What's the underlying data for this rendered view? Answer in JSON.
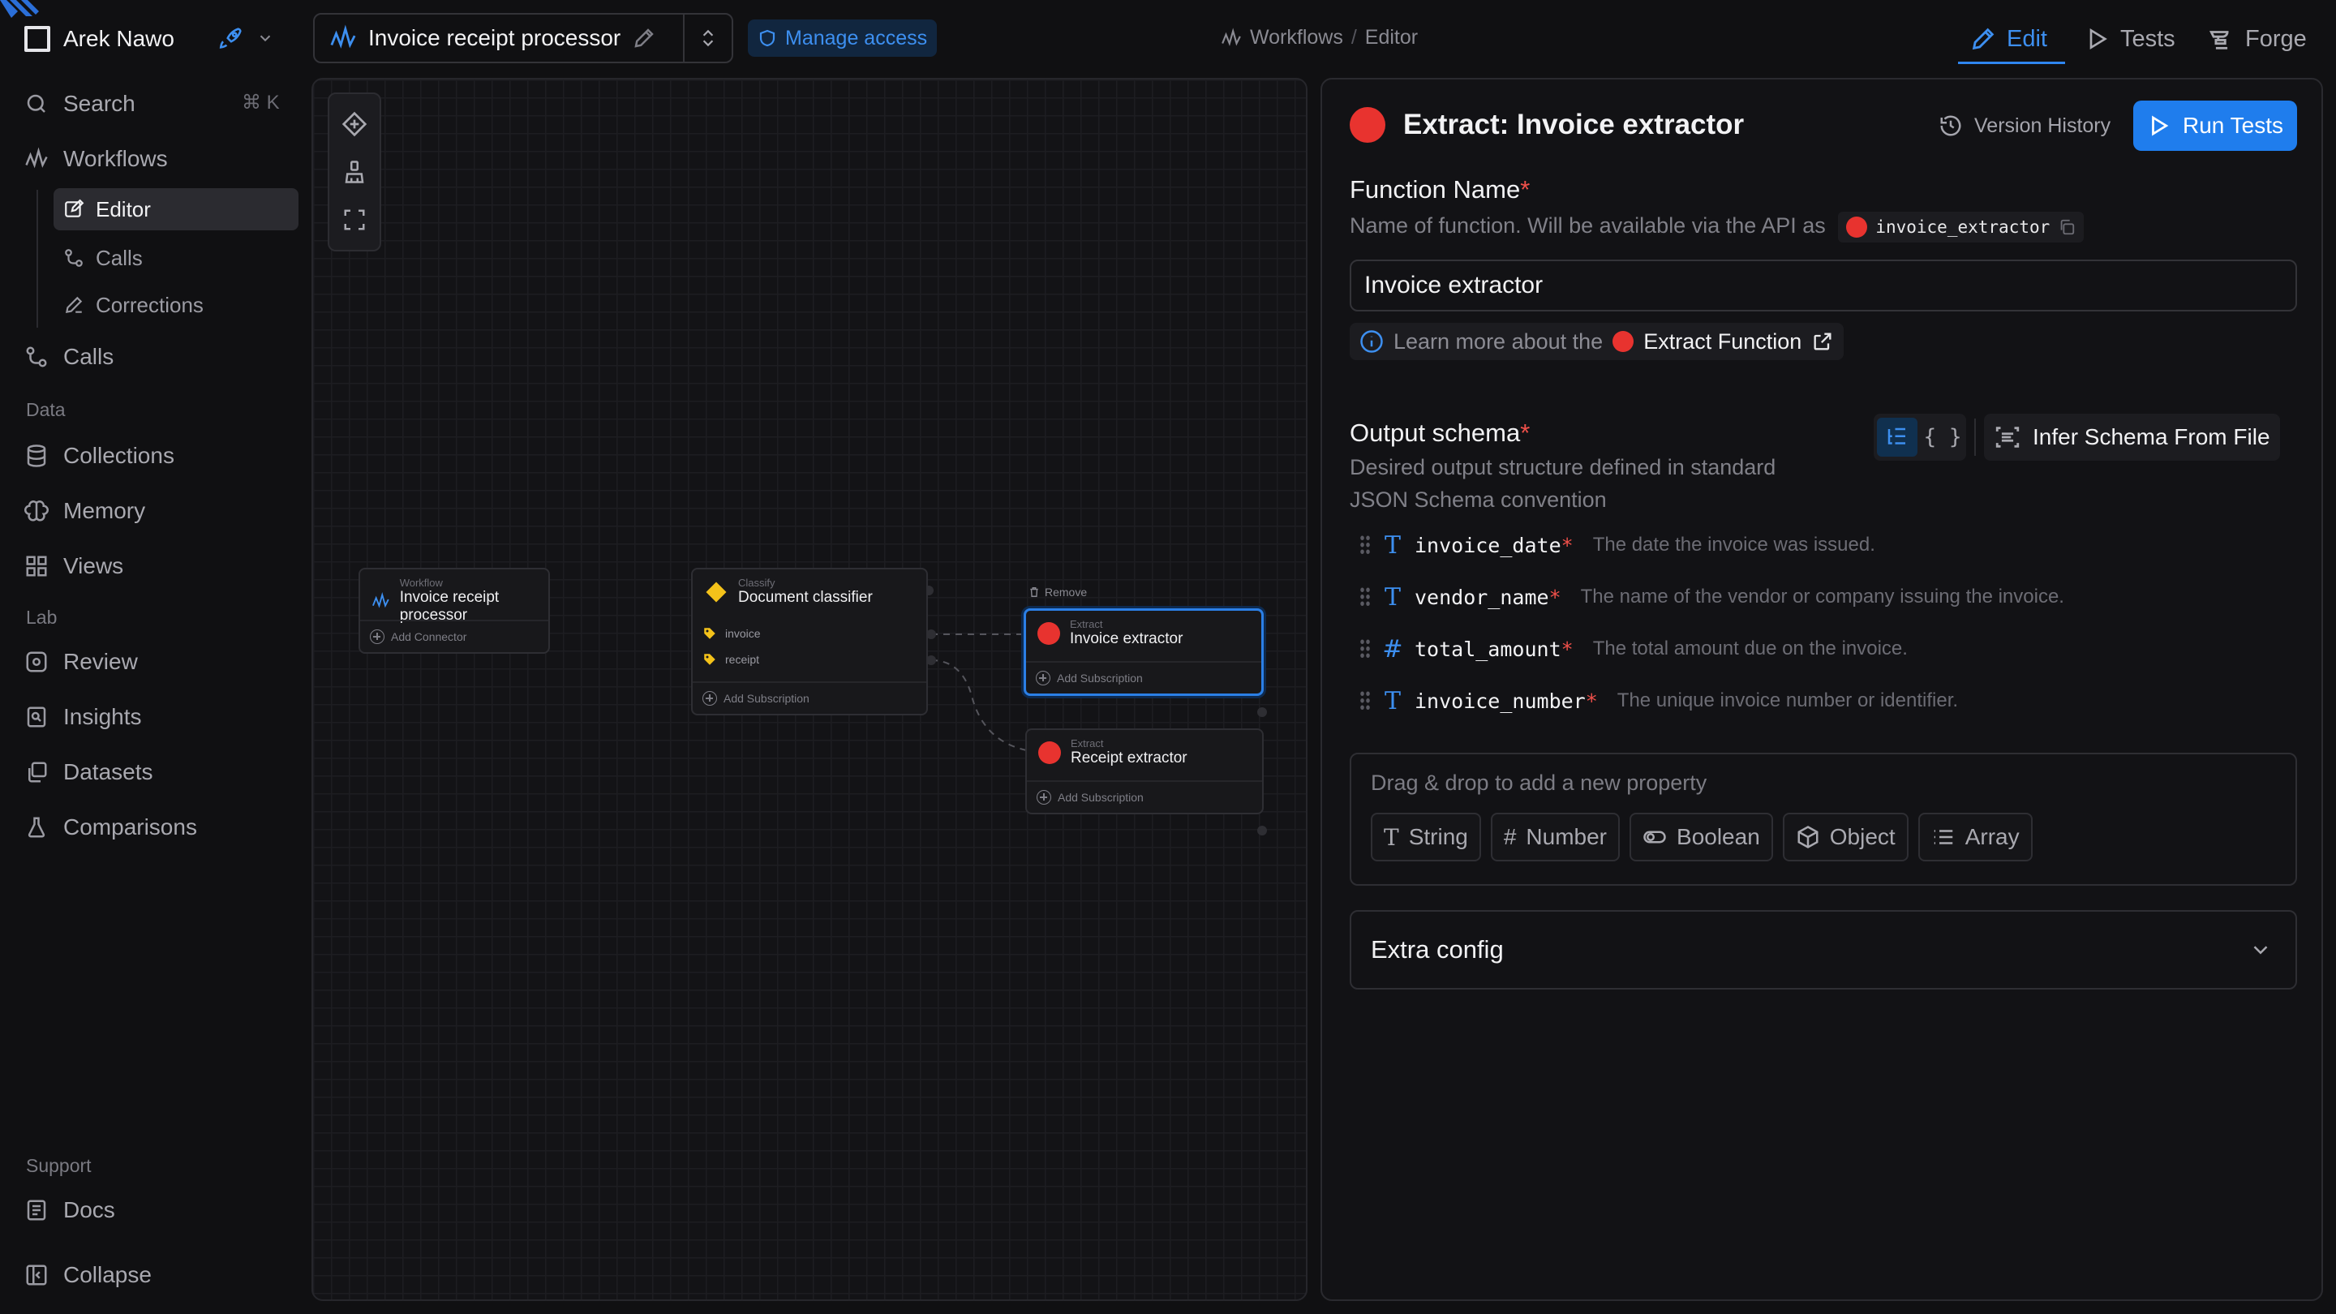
{
  "user": {
    "name": "Arek Nawo"
  },
  "search": {
    "label": "Search",
    "shortcut": "⌘ K"
  },
  "nav": {
    "workflows": "Workflows",
    "workflow_sub": [
      {
        "label": "Editor",
        "icon": "edit-icon",
        "active": true
      },
      {
        "label": "Calls",
        "icon": "calls-icon",
        "active": false
      },
      {
        "label": "Corrections",
        "icon": "pencil-icon",
        "active": false
      }
    ],
    "calls": "Calls",
    "data_section": "Data",
    "data_items": [
      "Collections",
      "Memory",
      "Views"
    ],
    "lab_section": "Lab",
    "lab_items": [
      "Review",
      "Insights",
      "Datasets",
      "Comparisons"
    ],
    "support_section": "Support",
    "docs": "Docs",
    "collapse": "Collapse"
  },
  "topbar": {
    "workflow_title": "Invoice receipt processor",
    "manage_access": "Manage access",
    "breadcrumb": [
      "Workflows",
      "/",
      "Editor"
    ],
    "tabs": {
      "edit": "Edit",
      "tests": "Tests",
      "forge": "Forge"
    },
    "accent": "#2f86f0"
  },
  "canvas": {
    "nodes": {
      "workflow": {
        "kicker": "Workflow",
        "title": "Invoice receipt processor",
        "footer": "Add Connector"
      },
      "classifier": {
        "kicker": "Classify",
        "title": "Document classifier",
        "classes": [
          "invoice",
          "receipt"
        ],
        "footer": "Add Subscription"
      },
      "invoice_extractor": {
        "kicker": "Extract",
        "title": "Invoice extractor",
        "footer": "Add Subscription",
        "remove": "Remove"
      },
      "receipt_extractor": {
        "kicker": "Extract",
        "title": "Receipt extractor",
        "footer": "Add Subscription"
      }
    }
  },
  "panel": {
    "title": "Extract: Invoice extractor",
    "version_history": "Version History",
    "run_tests": "Run Tests",
    "function_name": {
      "label": "Function Name",
      "required": "*",
      "desc": "Name of function. Will be available via the API as",
      "api_name": "invoice_extractor",
      "value": "Invoice extractor"
    },
    "learn_more": {
      "prefix": "Learn more about the",
      "link": "Extract Function"
    },
    "output_schema": {
      "label": "Output schema",
      "required": "*",
      "desc_1": "Desired output structure defined in standard",
      "desc_2": "JSON Schema convention",
      "infer": "Infer Schema From File",
      "properties": [
        {
          "type": "string",
          "icon": "T",
          "name": "invoice_date",
          "req": "*",
          "desc": "The date the invoice was issued."
        },
        {
          "type": "string",
          "icon": "T",
          "name": "vendor_name",
          "req": "*",
          "desc": "The name of the vendor or company issuing the invoice."
        },
        {
          "type": "number",
          "icon": "#",
          "name": "total_amount",
          "req": "*",
          "desc": "The total amount due on the invoice."
        },
        {
          "type": "string",
          "icon": "T",
          "name": "invoice_number",
          "req": "*",
          "desc": "The unique invoice number or identifier."
        }
      ],
      "dropzone_label": "Drag & drop to add a new property",
      "types": [
        "String",
        "Number",
        "Boolean",
        "Object",
        "Array"
      ]
    },
    "extra_config": "Extra config",
    "colors": {
      "primary": "#1f7ded",
      "extract_dot": "#e8332f",
      "required": "#f0504a"
    }
  }
}
